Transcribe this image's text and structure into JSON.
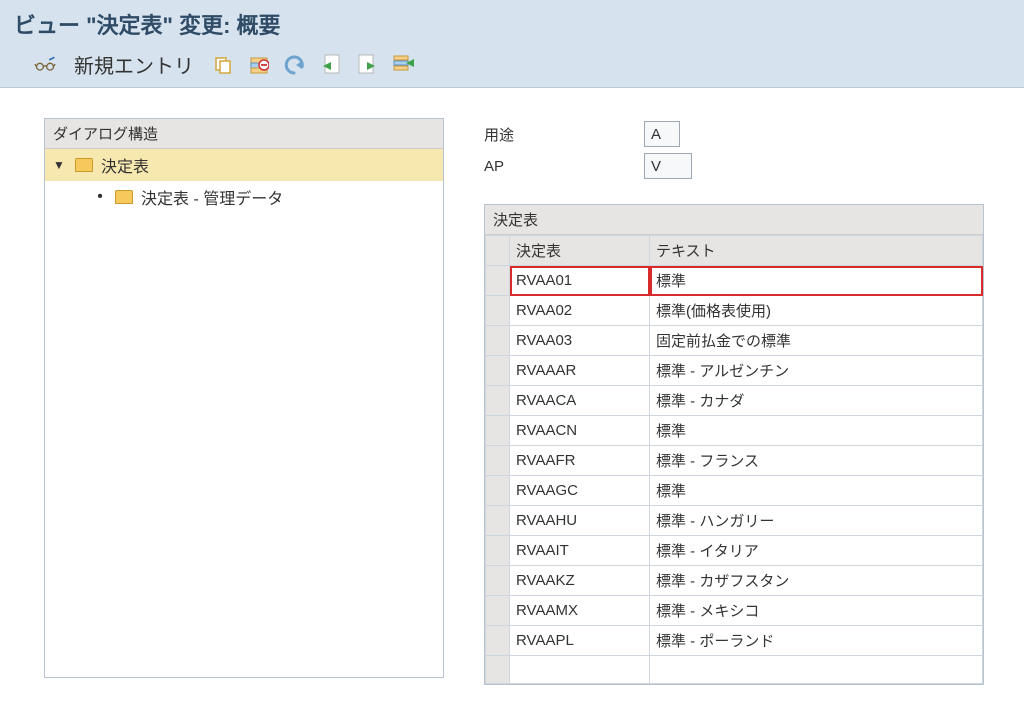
{
  "header": {
    "title": "ビュー \"決定表\" 変更: 概要"
  },
  "toolbar": {
    "new_entry_label": "新規エントリ"
  },
  "tree": {
    "header": "ダイアログ構造",
    "nodes": {
      "root": {
        "label": "決定表"
      },
      "child": {
        "label": "決定表 - 管理データ"
      }
    }
  },
  "form": {
    "usage_label": "用途",
    "usage_value": "A",
    "ap_label": "AP",
    "ap_value": "V"
  },
  "grid": {
    "title": "決定表",
    "col_code": "決定表",
    "col_text": "テキスト",
    "rows": [
      {
        "code": "RVAA01",
        "text": "標準"
      },
      {
        "code": "RVAA02",
        "text": "標準(価格表使用)"
      },
      {
        "code": "RVAA03",
        "text": "固定前払金での標準"
      },
      {
        "code": "RVAAAR",
        "text": "標準 - アルゼンチン"
      },
      {
        "code": "RVAACA",
        "text": "標準 - カナダ"
      },
      {
        "code": "RVAACN",
        "text": "標準"
      },
      {
        "code": "RVAAFR",
        "text": "標準 - フランス"
      },
      {
        "code": "RVAAGC",
        "text": "標準"
      },
      {
        "code": "RVAAHU",
        "text": "標準 - ハンガリー"
      },
      {
        "code": "RVAAIT",
        "text": "標準 - イタリア"
      },
      {
        "code": "RVAAKZ",
        "text": "標準 - カザフスタン"
      },
      {
        "code": "RVAAMX",
        "text": "標準 - メキシコ"
      },
      {
        "code": "RVAAPL",
        "text": "標準 - ポーランド"
      }
    ],
    "highlight_index": 0
  }
}
